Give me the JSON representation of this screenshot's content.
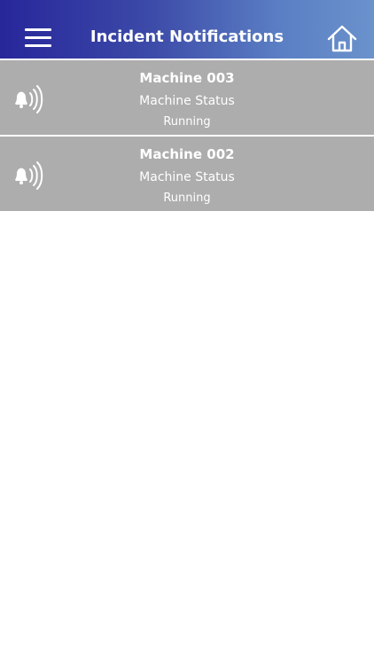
{
  "header": {
    "title": "Incident Notifications",
    "menu_icon": "hamburger-menu-icon",
    "home_icon": "home-icon",
    "gradient": [
      "#27269a",
      "#6a92cb"
    ]
  },
  "notifications": [
    {
      "machine": "Machine 003",
      "status_label": "Machine Status",
      "status_value": "Running",
      "icon": "alarm-bell-icon"
    },
    {
      "machine": "Machine 002",
      "status_label": "Machine Status",
      "status_value": "Running",
      "icon": "alarm-bell-icon"
    }
  ],
  "colors": {
    "row_background": "#adadad",
    "text": "#ffffff"
  }
}
